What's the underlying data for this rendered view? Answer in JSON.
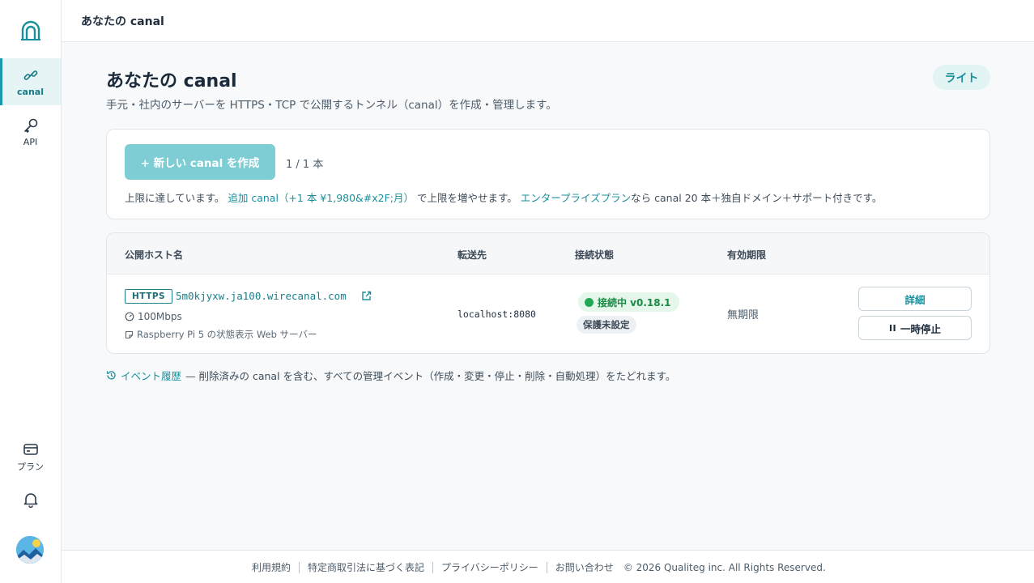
{
  "sidebar": {
    "items": [
      {
        "label": "canal",
        "icon": "link-icon",
        "active": true
      },
      {
        "label": "API",
        "icon": "key-icon"
      },
      {
        "label": "プラン",
        "icon": "wallet-icon"
      }
    ],
    "notification_icon": "bell-icon",
    "logo_icon": "canal-logo-icon"
  },
  "topbar": {
    "title": "あなたの canal"
  },
  "page": {
    "title": "あなたの canal",
    "subtitle": "手元・社内のサーバーを HTTPS・TCP で公開するトンネル（canal）を作成・管理します。",
    "plan_badge": "ライト"
  },
  "create": {
    "button_label": "+ 新しい canal を作成",
    "count": "1 / 1 本",
    "note_prefix": "上限に達しています。",
    "note_link1": "追加 canal（+1 本 ¥1,980&#x2F;月）",
    "note_mid": "で上限を増やせます。",
    "note_link2": "エンタープライズプラン",
    "note_suffix": "なら canal 20 本＋独自ドメイン＋サポート付きです。"
  },
  "table": {
    "headers": [
      "公開ホスト名",
      "転送先",
      "接続状態",
      "有効期限"
    ],
    "rows": [
      {
        "protocol": "HTTPS",
        "host": "5m0kjyxw.ja100.wirecanal.com",
        "speed": "100Mbps",
        "description": "Raspberry Pi 5 の状態表示 Web サーバー",
        "destination": "localhost:8080",
        "status": "接続中 v0.18.1",
        "protection": "保護未設定",
        "expiry": "無期限",
        "detail_label": "詳細",
        "pause_label": "一時停止"
      }
    ]
  },
  "history": {
    "link": "イベント履歴",
    "text": "— 削除済みの canal を含む、すべての管理イベント（作成・変更・停止・削除・自動処理）をたどれます。"
  },
  "footer": {
    "links": [
      "利用規約",
      "特定商取引法に基づく表記",
      "プライバシーポリシー",
      "お問い合わせ"
    ],
    "copyright": "© 2026 Qualiteg inc. All Rights Reserved."
  },
  "colors": {
    "accent": "#1a9aa8",
    "status_green": "#22a854"
  }
}
